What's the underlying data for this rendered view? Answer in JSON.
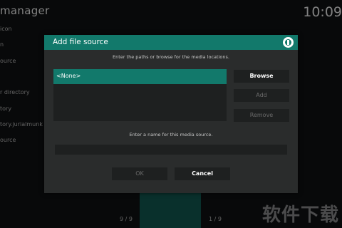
{
  "background": {
    "title": "manager",
    "clock": "10:09",
    "items": [
      "icon",
      "n",
      "ource",
      "r directory",
      "tory",
      "tory.jurialmunk",
      "ource"
    ],
    "page_left": "9 / 9",
    "page_right": "1 / 9"
  },
  "dialog": {
    "title": "Add file source",
    "instruction": "Enter the paths or browse for the media locations.",
    "paths": [
      "<None>"
    ],
    "browse_label": "Browse",
    "add_label": "Add",
    "remove_label": "Remove",
    "name_label": "Enter a name for this media source.",
    "name_value": "",
    "ok_label": "OK",
    "cancel_label": "Cancel",
    "logo_icon": "kodi-power-icon"
  },
  "watermark": "软件下载",
  "colors": {
    "accent": "#12796b",
    "dialog_bg": "#2a2c2c",
    "control_bg": "#1e2020",
    "disabled_text": "#6a6a6a"
  }
}
